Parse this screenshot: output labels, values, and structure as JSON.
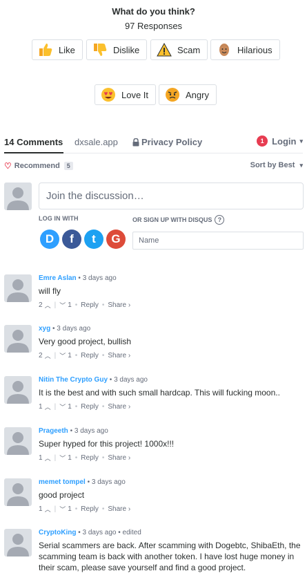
{
  "reactions": {
    "title": "What do you think?",
    "responses": "97 Responses",
    "items": [
      {
        "label": "Like",
        "icon": "thumbs-up-emoji"
      },
      {
        "label": "Dislike",
        "icon": "thumbs-down-emoji"
      },
      {
        "label": "Scam",
        "icon": "warning-emoji"
      },
      {
        "label": "Hilarious",
        "icon": "laughing-face-emoji"
      },
      {
        "label": "Love It",
        "icon": "heart-eyes-emoji"
      },
      {
        "label": "Angry",
        "icon": "angry-face-emoji"
      }
    ]
  },
  "tabs": {
    "comments": "14 Comments",
    "site": "dxsale.app",
    "privacy": "Privacy Policy",
    "login": "Login",
    "login_badge": "1"
  },
  "toolbar": {
    "recommend": "Recommend",
    "recommend_count": "5",
    "sort": "Sort by Best"
  },
  "compose": {
    "placeholder": "Join the discussion…",
    "log_in_with": "LOG IN WITH",
    "signup": "OR SIGN UP WITH DISQUS",
    "help": "?",
    "name_placeholder": "Name",
    "social": [
      {
        "letter": "D",
        "color": "#2e9fff",
        "name": "disqus"
      },
      {
        "letter": "f",
        "color": "#3b5998",
        "name": "facebook"
      },
      {
        "letter": "t",
        "color": "#1da1f2",
        "name": "twitter"
      },
      {
        "letter": "G",
        "color": "#dd4b39",
        "name": "google"
      }
    ]
  },
  "colors": {
    "accent": "#2e9fff",
    "badge": "#e73c51",
    "text": "#2a2e2e",
    "muted": "#656c7a"
  },
  "comments": [
    {
      "author": "Emre Aslan",
      "time": "3 days ago",
      "edited": "",
      "text": "will fly",
      "up": "2",
      "down": "1",
      "reply": "Reply",
      "share": "Share ›"
    },
    {
      "author": "xyg",
      "time": "3 days ago",
      "edited": "",
      "text": "Very good project, bullish",
      "up": "2",
      "down": "1",
      "reply": "Reply",
      "share": "Share ›"
    },
    {
      "author": "Nitin The Crypto Guy",
      "time": "3 days ago",
      "edited": "",
      "text": "It is the best and with such small hardcap. This will fucking moon..",
      "up": "1",
      "down": "1",
      "reply": "Reply",
      "share": "Share ›"
    },
    {
      "author": "Prageeth",
      "time": "3 days ago",
      "edited": "",
      "text": "Super hyped for this project! 1000x!!!",
      "up": "1",
      "down": "1",
      "reply": "Reply",
      "share": "Share ›"
    },
    {
      "author": "memet tompel",
      "time": "3 days ago",
      "edited": "",
      "text": "good project",
      "up": "1",
      "down": "1",
      "reply": "Reply",
      "share": "Share ›"
    },
    {
      "author": "CryptoKing",
      "time": "3 days ago",
      "edited": "edited",
      "text": "Serial scammers are back. After scamming with Dogebtc, ShibaEth, the scamming team is back with another token. I have lost huge money in their scam, please save yourself and find a good project.",
      "up": "",
      "down": "",
      "reply": "",
      "share": ""
    }
  ]
}
